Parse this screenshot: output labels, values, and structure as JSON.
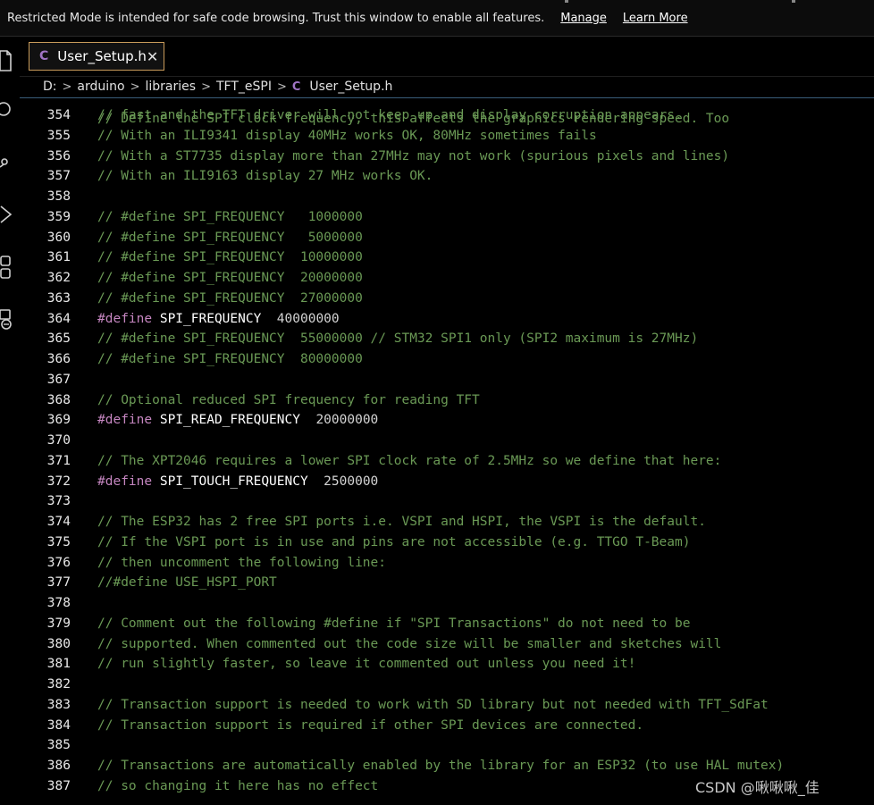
{
  "banner": {
    "message": "Restricted Mode is intended for safe code browsing. Trust this window to enable all features.",
    "manage_label": "Manage",
    "learn_more_label": "Learn More"
  },
  "tab": {
    "file_icon": "C",
    "label": "User_Setup.h",
    "close_icon": "✕"
  },
  "breadcrumb": {
    "segments": [
      "D:",
      "arduino",
      "libraries",
      "TFT_eSPI"
    ],
    "separator": ">",
    "file_icon": "C",
    "file": "User_Setup.h"
  },
  "editor": {
    "partial_top_line": "// Define the SPI clock frequency, this affects the graphics rendering speed. Too",
    "lines": [
      {
        "n": "354",
        "t": "// fast and the TFT driver will not keep up and display corruption appears."
      },
      {
        "n": "355",
        "t": "// With an ILI9341 display 40MHz works OK, 80MHz sometimes fails"
      },
      {
        "n": "356",
        "t": "// With a ST7735 display more than 27MHz may not work (spurious pixels and lines)"
      },
      {
        "n": "357",
        "t": "// With an ILI9163 display 27 MHz works OK."
      },
      {
        "n": "358",
        "t": ""
      },
      {
        "n": "359",
        "t": "// #define SPI_FREQUENCY   1000000"
      },
      {
        "n": "360",
        "t": "// #define SPI_FREQUENCY   5000000"
      },
      {
        "n": "361",
        "t": "// #define SPI_FREQUENCY  10000000"
      },
      {
        "n": "362",
        "t": "// #define SPI_FREQUENCY  20000000"
      },
      {
        "n": "363",
        "t": "// #define SPI_FREQUENCY  27000000"
      },
      {
        "n": "364",
        "d": "#define",
        "m": "SPI_FREQUENCY",
        "v": "  40000000"
      },
      {
        "n": "365",
        "t": "// #define SPI_FREQUENCY  55000000 // STM32 SPI1 only (SPI2 maximum is 27MHz)"
      },
      {
        "n": "366",
        "t": "// #define SPI_FREQUENCY  80000000"
      },
      {
        "n": "367",
        "t": ""
      },
      {
        "n": "368",
        "t": "// Optional reduced SPI frequency for reading TFT"
      },
      {
        "n": "369",
        "d": "#define",
        "m": "SPI_READ_FREQUENCY",
        "v": "  20000000"
      },
      {
        "n": "370",
        "t": ""
      },
      {
        "n": "371",
        "t": "// The XPT2046 requires a lower SPI clock rate of 2.5MHz so we define that here:"
      },
      {
        "n": "372",
        "d": "#define",
        "m": "SPI_TOUCH_FREQUENCY",
        "v": "  2500000"
      },
      {
        "n": "373",
        "t": ""
      },
      {
        "n": "374",
        "t": "// The ESP32 has 2 free SPI ports i.e. VSPI and HSPI, the VSPI is the default."
      },
      {
        "n": "375",
        "t": "// If the VSPI port is in use and pins are not accessible (e.g. TTGO T-Beam)"
      },
      {
        "n": "376",
        "t": "// then uncomment the following line:"
      },
      {
        "n": "377",
        "t": "//#define USE_HSPI_PORT"
      },
      {
        "n": "378",
        "t": ""
      },
      {
        "n": "379",
        "t": "// Comment out the following #define if \"SPI Transactions\" do not need to be"
      },
      {
        "n": "380",
        "t": "// supported. When commented out the code size will be smaller and sketches will"
      },
      {
        "n": "381",
        "t": "// run slightly faster, so leave it commented out unless you need it!"
      },
      {
        "n": "382",
        "t": ""
      },
      {
        "n": "383",
        "t": "// Transaction support is needed to work with SD library but not needed with TFT_SdFat"
      },
      {
        "n": "384",
        "t": "// Transaction support is required if other SPI devices are connected."
      },
      {
        "n": "385",
        "t": ""
      },
      {
        "n": "386",
        "t": "// Transactions are automatically enabled by the library for an ESP32 (to use HAL mutex)"
      },
      {
        "n": "387",
        "t": "// so changing it here has no effect"
      }
    ]
  },
  "watermark": "CSDN @啾啾啾_佳",
  "colors": {
    "comment": "#6a9955",
    "preprocessor": "#c586c0",
    "tab_border": "#c89b5a",
    "c_file_icon": "#a074c4"
  }
}
